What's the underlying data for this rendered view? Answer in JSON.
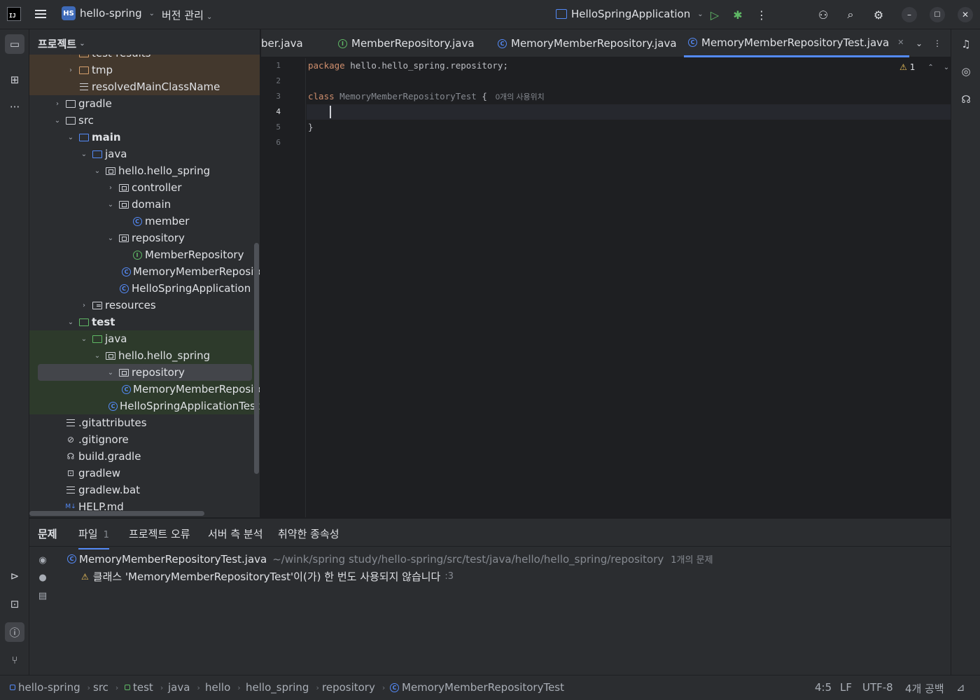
{
  "titlebar": {
    "logo_text": "IJ",
    "project_badge": "HS",
    "project_name": "hello-spring",
    "vcs_label": "버전 관리",
    "run_config": "HelloSpringApplication"
  },
  "project_panel": {
    "title": "프로젝트",
    "tree": [
      {
        "label": "test-results",
        "arrow": "›",
        "icon": "folder-excl",
        "excluded": true
      },
      {
        "label": "tmp",
        "arrow": "›",
        "icon": "folder-excl",
        "excluded": true
      },
      {
        "label": "resolvedMainClassName",
        "arrow": "",
        "icon": "lines",
        "excluded": true
      },
      {
        "label": "gradle",
        "arrow": "›",
        "icon": "folder"
      },
      {
        "label": "src",
        "arrow": "⌄",
        "icon": "folder"
      },
      {
        "label": "main",
        "arrow": "⌄",
        "icon": "folder-src",
        "bold": true
      },
      {
        "label": "java",
        "arrow": "⌄",
        "icon": "folder-src"
      },
      {
        "label": "hello.hello_spring",
        "arrow": "⌄",
        "icon": "package"
      },
      {
        "label": "controller",
        "arrow": "›",
        "icon": "package"
      },
      {
        "label": "domain",
        "arrow": "⌄",
        "icon": "package"
      },
      {
        "label": "member",
        "arrow": "",
        "icon": "class"
      },
      {
        "label": "repository",
        "arrow": "⌄",
        "icon": "package"
      },
      {
        "label": "MemberRepository",
        "arrow": "",
        "icon": "interface"
      },
      {
        "label": "MemoryMemberRepository",
        "arrow": "",
        "icon": "class"
      },
      {
        "label": "HelloSpringApplication",
        "arrow": "",
        "icon": "class"
      },
      {
        "label": "resources",
        "arrow": "›",
        "icon": "folder-res"
      },
      {
        "label": "test",
        "arrow": "⌄",
        "icon": "folder-test",
        "bold": true
      },
      {
        "label": "java",
        "arrow": "⌄",
        "icon": "folder-test",
        "testsrc": true
      },
      {
        "label": "hello.hello_spring",
        "arrow": "⌄",
        "icon": "package",
        "testsrc": true
      },
      {
        "label": "repository",
        "arrow": "⌄",
        "icon": "package",
        "testsrc": true,
        "selected": true
      },
      {
        "label": "MemoryMemberRepositoryTest",
        "arrow": "",
        "icon": "class",
        "testsrc": true
      },
      {
        "label": "HelloSpringApplicationTests",
        "arrow": "",
        "icon": "class",
        "testsrc": true
      },
      {
        "label": ".gitattributes",
        "arrow": "",
        "icon": "lines"
      },
      {
        "label": ".gitignore",
        "arrow": "",
        "icon": "ignore"
      },
      {
        "label": "build.gradle",
        "arrow": "",
        "icon": "gradle"
      },
      {
        "label": "gradlew",
        "arrow": "",
        "icon": "terminal"
      },
      {
        "label": "gradlew.bat",
        "arrow": "",
        "icon": "lines"
      },
      {
        "label": "HELP.md",
        "arrow": "",
        "icon": "md"
      }
    ]
  },
  "tabs": [
    {
      "label": "ber.java",
      "icon": "",
      "active": false
    },
    {
      "label": "MemberRepository.java",
      "icon": "interface",
      "active": false
    },
    {
      "label": "MemoryMemberRepository.java",
      "icon": "class",
      "active": false
    },
    {
      "label": "MemoryMemberRepositoryTest.java",
      "icon": "class",
      "active": true,
      "closable": true
    }
  ],
  "editor": {
    "line_numbers": [
      "1",
      "2",
      "3",
      "4",
      "5",
      "6"
    ],
    "current_line": "4",
    "line1_keyword": "package",
    "line1_rest": " hello.hello_spring.repository;",
    "line3_keyword": "class",
    "line3_name": " MemoryMemberRepositoryTest",
    "line3_brace": " {",
    "line3_hint": "0개의 사용위치",
    "line5": "}",
    "warning_count": "1"
  },
  "problems": {
    "tabs": [
      {
        "label": "문제",
        "bold": true
      },
      {
        "label": "파일",
        "count": "1"
      },
      {
        "label": "프로젝트 오류"
      },
      {
        "label": "서버 측 분석"
      },
      {
        "label": "취약한 종속성"
      }
    ],
    "file_name": "MemoryMemberRepositoryTest.java",
    "file_path": "~/wink/spring study/hello-spring/src/test/java/hello/hello_spring/repository",
    "file_count": "1개의 문제",
    "issue_text": "클래스 'MemoryMemberRepositoryTest'이(가) 한 번도 사용되지 않습니다",
    "issue_loc": ":3"
  },
  "statusbar": {
    "crumbs": [
      "hello-spring",
      "src",
      "test",
      "java",
      "hello",
      "hello_spring",
      "repository",
      "MemoryMemberRepositoryTest"
    ],
    "position": "4:5",
    "line_sep": "LF",
    "encoding": "UTF-8",
    "indent": "4개 공백"
  },
  "colors": {
    "accent": "#548af7",
    "keyword": "#cf8e6d",
    "warning": "#f2c55c",
    "run": "#5fb865"
  }
}
